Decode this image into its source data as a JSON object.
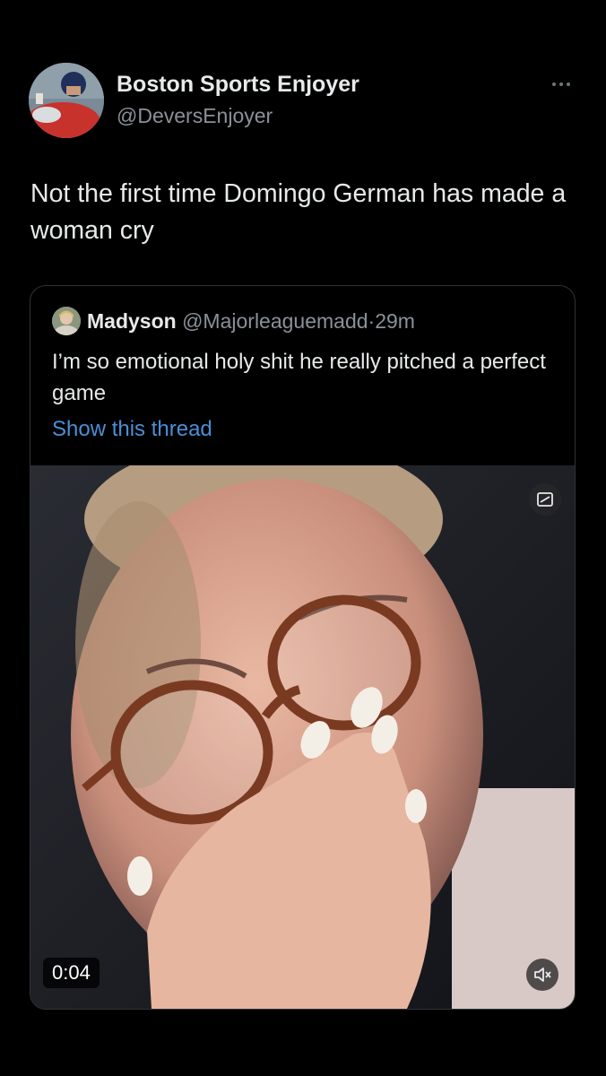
{
  "tweet": {
    "author": {
      "display_name": "Boston Sports Enjoyer",
      "handle": "@DeversEnjoyer",
      "avatar_icon": "user-avatar"
    },
    "more_icon": "more-horizontal-icon",
    "text": "Not the first time Domingo German has made a woman cry"
  },
  "quote": {
    "author": {
      "display_name": "Madyson",
      "handle": "@Majorleaguemadd",
      "avatar_icon": "user-avatar"
    },
    "separator": "·",
    "time": "29m",
    "text": "I’m so emotional holy shit he really pitched a perfect game",
    "thread_link": "Show this thread",
    "media": {
      "type": "video",
      "duration": "0:04",
      "corner_icon": "media-badge-icon",
      "mute_icon": "volume-muted-icon"
    }
  },
  "colors": {
    "background": "#000000",
    "text_primary": "#e7e9ea",
    "text_secondary": "#8b9198",
    "link": "#4a8fd6",
    "border": "#2f3336"
  }
}
